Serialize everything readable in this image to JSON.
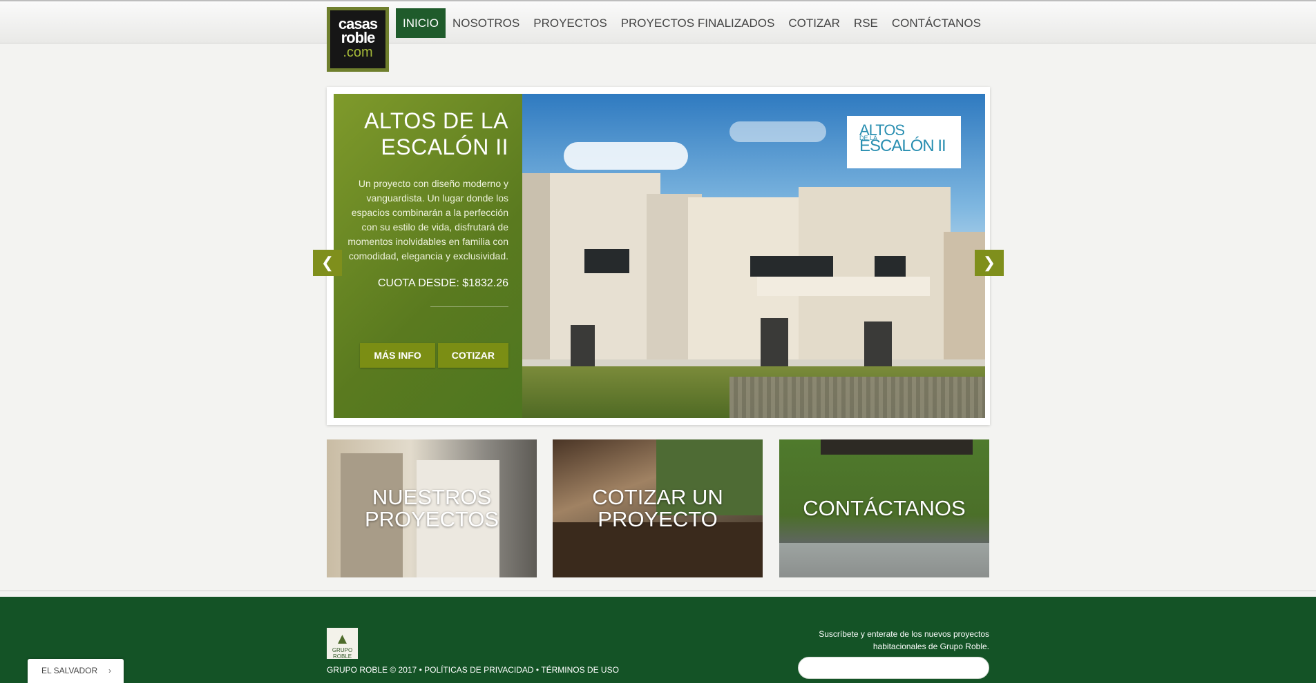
{
  "brand": {
    "logo_line1": "casas",
    "logo_line2": "roble",
    "logo_line3": ".com"
  },
  "nav": {
    "items": [
      {
        "label": "INICIO",
        "active": true
      },
      {
        "label": "NOSOTROS"
      },
      {
        "label": "PROYECTOS"
      },
      {
        "label": "PROYECTOS FINALIZADOS"
      },
      {
        "label": "COTIZAR"
      },
      {
        "label": "RSE"
      },
      {
        "label": "CONTÁCTANOS"
      }
    ]
  },
  "slider": {
    "title": "ALTOS DE LA ESCALÓN II",
    "description": "Un proyecto con diseño moderno y vanguardista. Un lugar donde los espacios combinarán a la perfección con su estilo de vida, disfrutará de momentos inolvidables en familia con comodidad, elegancia y exclusividad.",
    "price": "CUOTA DESDE: $1832.26",
    "buttons": {
      "more_info": "MÁS INFO",
      "quote": "COTIZAR"
    },
    "badge": {
      "line1": "ALTOS",
      "line2": "DE LA",
      "line3": "ESCALÓN II"
    },
    "prev_icon": "chevron-left-icon",
    "next_icon": "chevron-right-icon"
  },
  "tiles": [
    {
      "label": "NUESTROS PROYECTOS"
    },
    {
      "label": "COTIZAR UN PROYECTO"
    },
    {
      "label": "CONTÁCTANOS"
    }
  ],
  "footer": {
    "logo_text": "GRUPO ROBLE",
    "copyright": "GRUPO ROBLE © 2017",
    "privacy": "POLÍTICAS DE PRIVACIDAD",
    "terms": "TÉRMINOS DE USO",
    "separator": " • ",
    "subscribe_text": "Suscríbete y enterate de los nuevos proyectos habitacionales de Grupo Roble.",
    "email_value": ""
  },
  "country_selector": {
    "label": "EL SALVADOR",
    "icon": "chevron-right-icon"
  },
  "colors": {
    "brand_green": "#1f5b2b",
    "olive": "#7b8e14",
    "footer_bg": "#145326"
  }
}
